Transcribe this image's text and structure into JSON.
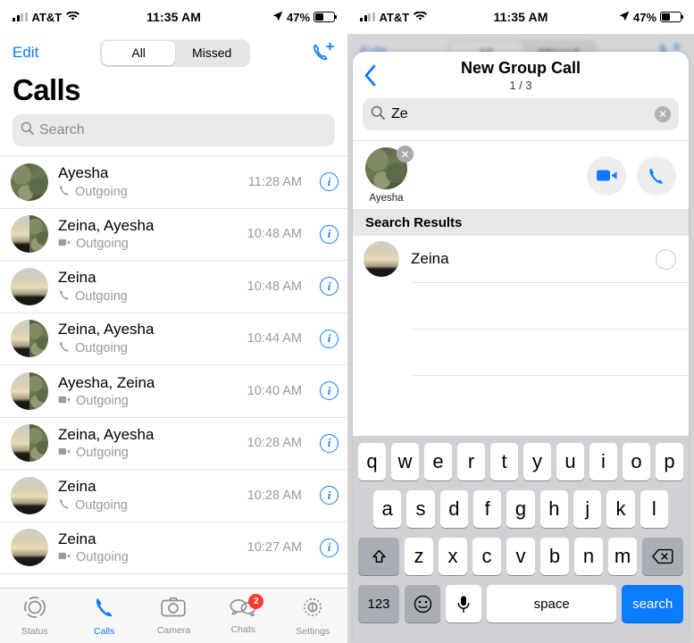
{
  "status_bar": {
    "carrier": "AT&T",
    "time": "11:35 AM",
    "battery_percent": "47%",
    "wifi_icon": "wifi-icon",
    "location_icon": "location-arrow-icon"
  },
  "left": {
    "nav": {
      "edit_label": "Edit",
      "segments": [
        {
          "label": "All",
          "selected": true
        },
        {
          "label": "Missed",
          "selected": false
        }
      ],
      "new_call_icon": "phone-plus-icon"
    },
    "title": "Calls",
    "search_placeholder": "Search",
    "search_icon": "search-icon",
    "calls": [
      {
        "name": "Ayesha",
        "type": "Outgoing",
        "media": "voice",
        "time": "11:28 AM",
        "avatar": "camo"
      },
      {
        "name": "Zeina, Ayesha",
        "type": "Outgoing",
        "media": "video",
        "time": "10:48 AM",
        "avatar": "group"
      },
      {
        "name": "Zeina",
        "type": "Outgoing",
        "media": "voice",
        "time": "10:48 AM",
        "avatar": "sunset"
      },
      {
        "name": "Zeina, Ayesha",
        "type": "Outgoing",
        "media": "voice",
        "time": "10:44 AM",
        "avatar": "group"
      },
      {
        "name": "Ayesha, Zeina",
        "type": "Outgoing",
        "media": "video",
        "time": "10:40 AM",
        "avatar": "group"
      },
      {
        "name": "Zeina, Ayesha",
        "type": "Outgoing",
        "media": "video",
        "time": "10:28 AM",
        "avatar": "group"
      },
      {
        "name": "Zeina",
        "type": "Outgoing",
        "media": "voice",
        "time": "10:28 AM",
        "avatar": "sunset"
      },
      {
        "name": "Zeina",
        "type": "Outgoing",
        "media": "video",
        "time": "10:27 AM",
        "avatar": "sunset"
      }
    ],
    "tabs": [
      {
        "label": "Status",
        "icon": "status-rings-icon",
        "active": false,
        "badge": ""
      },
      {
        "label": "Calls",
        "icon": "phone-icon",
        "active": true,
        "badge": ""
      },
      {
        "label": "Camera",
        "icon": "camera-icon",
        "active": false,
        "badge": ""
      },
      {
        "label": "Chats",
        "icon": "chat-bubbles-icon",
        "active": false,
        "badge": "2"
      },
      {
        "label": "Settings",
        "icon": "gear-icon",
        "active": false,
        "badge": ""
      }
    ]
  },
  "right": {
    "sheet": {
      "back_icon": "chevron-left-icon",
      "title": "New Group Call",
      "count": "1 / 3",
      "search_icon": "search-icon",
      "search_value": "Ze",
      "clear_icon": "clear-circle-icon",
      "selected": [
        {
          "name": "Ayesha",
          "avatar": "camo",
          "remove_icon": "close-icon"
        }
      ],
      "video_call_icon": "video-camera-icon",
      "voice_call_icon": "phone-icon",
      "results_header": "Search Results",
      "results": [
        {
          "name": "Zeina",
          "avatar": "sunset",
          "selected": false
        }
      ]
    },
    "keyboard": {
      "row1": [
        "q",
        "w",
        "e",
        "r",
        "t",
        "y",
        "u",
        "i",
        "o",
        "p"
      ],
      "row2": [
        "a",
        "s",
        "d",
        "f",
        "g",
        "h",
        "j",
        "k",
        "l"
      ],
      "row3": [
        "z",
        "x",
        "c",
        "v",
        "b",
        "n",
        "m"
      ],
      "shift_icon": "shift-up-icon",
      "backspace_icon": "backspace-icon",
      "numbers_label": "123",
      "emoji_icon": "smiley-icon",
      "mic_icon": "microphone-icon",
      "space_label": "space",
      "search_label": "search"
    }
  },
  "colors": {
    "accent_blue": "#0a7cff",
    "badge_red": "#ff3b30",
    "secondary_gray": "#9a9a9f",
    "keyboard_bg": "#cfd1d6"
  }
}
